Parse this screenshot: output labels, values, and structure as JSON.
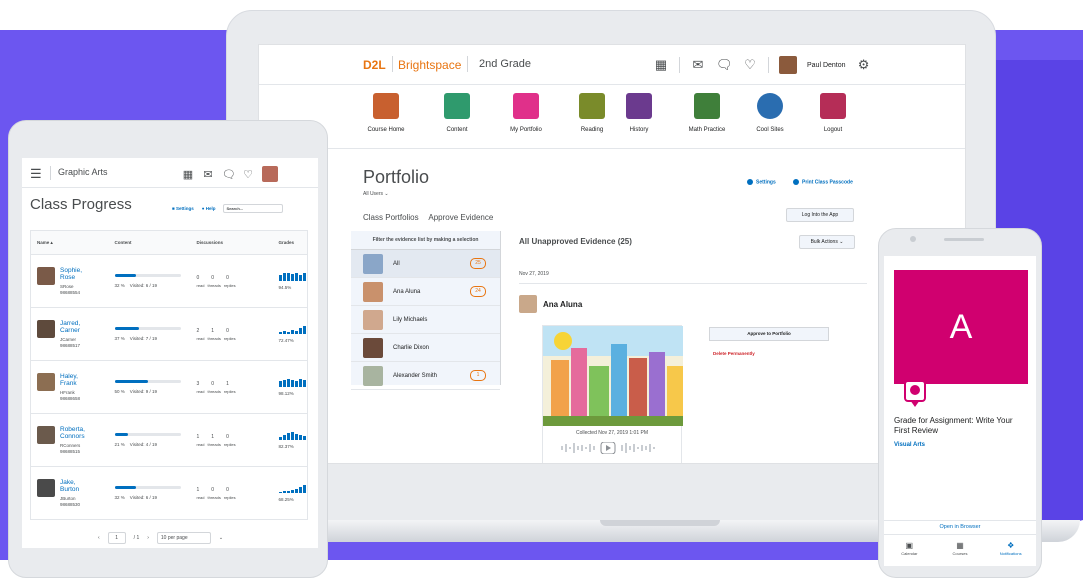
{
  "colors": {
    "accent_purple": "#6c56f0",
    "brand_orange": "#e87511",
    "link_blue": "#006fbf",
    "hero_pink": "#d0006f",
    "danger_red": "#cd2026"
  },
  "laptop": {
    "logo": "D2L",
    "brand": "Brightspace",
    "course": "2nd Grade",
    "top_icons": [
      "grid-icon",
      "mail-icon",
      "chat-icon",
      "bell-icon"
    ],
    "user_name": "Paul Denton",
    "nav_tiles": [
      {
        "label": "Course Home",
        "icon": "house-icon",
        "color": "#c8602f"
      },
      {
        "label": "Content",
        "icon": "book-icon",
        "color": "#2f9a6d"
      },
      {
        "label": "My Portfolio",
        "icon": "portfolio-icon",
        "color": "#e0308a"
      },
      {
        "label": "Reading",
        "icon": "reading-icon",
        "color": "#7a8b2a"
      },
      {
        "label": "History",
        "icon": "museum-icon",
        "color": "#6b3a8e"
      },
      {
        "label": "Math Practice",
        "icon": "calculator-icon",
        "color": "#3f7f3a"
      },
      {
        "label": "Cool Sites",
        "icon": "globe-icon",
        "color": "#2a6db0"
      },
      {
        "label": "Logout",
        "icon": "logout-icon",
        "color": "#b52d57"
      }
    ],
    "page_title": "Portfolio",
    "user_filter": "All Users",
    "settings_link": "Settings",
    "print_link": "Print Class Passcode",
    "tabs": [
      "Class Portfolios",
      "Approve Evidence"
    ],
    "log_into_app": "Log Into the App",
    "filter_heading": "Filter the evidence list by making a selection",
    "filter_items": [
      {
        "name": "All",
        "count": "25"
      },
      {
        "name": "Ana Aluna",
        "count": "24"
      },
      {
        "name": "Lily Michaels",
        "count": ""
      },
      {
        "name": "Charlie Dixon",
        "count": ""
      },
      {
        "name": "Alexander Smith",
        "count": "1"
      }
    ],
    "evidence_title": "All Unapproved Evidence (25)",
    "bulk_actions": "Bulk Actions",
    "evidence_date": "Nov 27, 2019",
    "evidence_person": "Ana Aluna",
    "collected": "Collected Nov 27, 2019 1:01 PM",
    "approve": "Approve to Portfolio",
    "delete": "Delete Permanently"
  },
  "tablet": {
    "course": "Graphic Arts",
    "title": "Class Progress",
    "settings_link": "Settings",
    "help_link": "Help",
    "search_placeholder": "Search...",
    "columns": [
      "Name",
      "Content",
      "Discussions",
      "Grades"
    ],
    "rows": [
      {
        "first": "Sophie,",
        "last": "Rose",
        "user": "SRose",
        "id": "98688554",
        "content_pct": "32 %",
        "visited": "Visited: 6 / 19",
        "progress": 0.32,
        "posts": "0",
        "threads": "0",
        "replies": "0",
        "grade": "94.5%"
      },
      {
        "first": "Jarred,",
        "last": "Carner",
        "user": "JCarner",
        "id": "98688517",
        "content_pct": "37 %",
        "visited": "Visited: 7 / 19",
        "progress": 0.37,
        "posts": "2",
        "threads": "1",
        "replies": "0",
        "grade": "72.47%"
      },
      {
        "first": "Haley,",
        "last": "Frank",
        "user": "HFrank",
        "id": "98688658",
        "content_pct": "50 %",
        "visited": "Visited: 9 / 19",
        "progress": 0.5,
        "posts": "3",
        "threads": "0",
        "replies": "1",
        "grade": "98.12%"
      },
      {
        "first": "Roberta,",
        "last": "Connors",
        "user": "RConners",
        "id": "98688515",
        "content_pct": "21 %",
        "visited": "Visited: 4 / 19",
        "progress": 0.21,
        "posts": "1",
        "threads": "1",
        "replies": "0",
        "grade": "82.37%"
      },
      {
        "first": "Jake,",
        "last": "Burton",
        "user": "JBurton",
        "id": "98688530",
        "content_pct": "32 %",
        "visited": "Visited: 6 / 19",
        "progress": 0.32,
        "posts": "1",
        "threads": "0",
        "replies": "0",
        "grade": "68.25%"
      }
    ],
    "disc_labels": [
      "read",
      "threads",
      "replies"
    ],
    "pager": {
      "page": "1",
      "of": "/ 1",
      "per_page": "10 per page"
    }
  },
  "phone": {
    "hero_letter": "A",
    "title": "Grade for Assignment: Write Your First Review",
    "course": "Visual Arts",
    "open_browser": "Open in Browser",
    "tabs": [
      {
        "label": "Calendar",
        "icon": "calendar-icon"
      },
      {
        "label": "Courses",
        "icon": "grid-icon"
      },
      {
        "label": "Notifications",
        "icon": "broadcast-icon"
      }
    ]
  }
}
